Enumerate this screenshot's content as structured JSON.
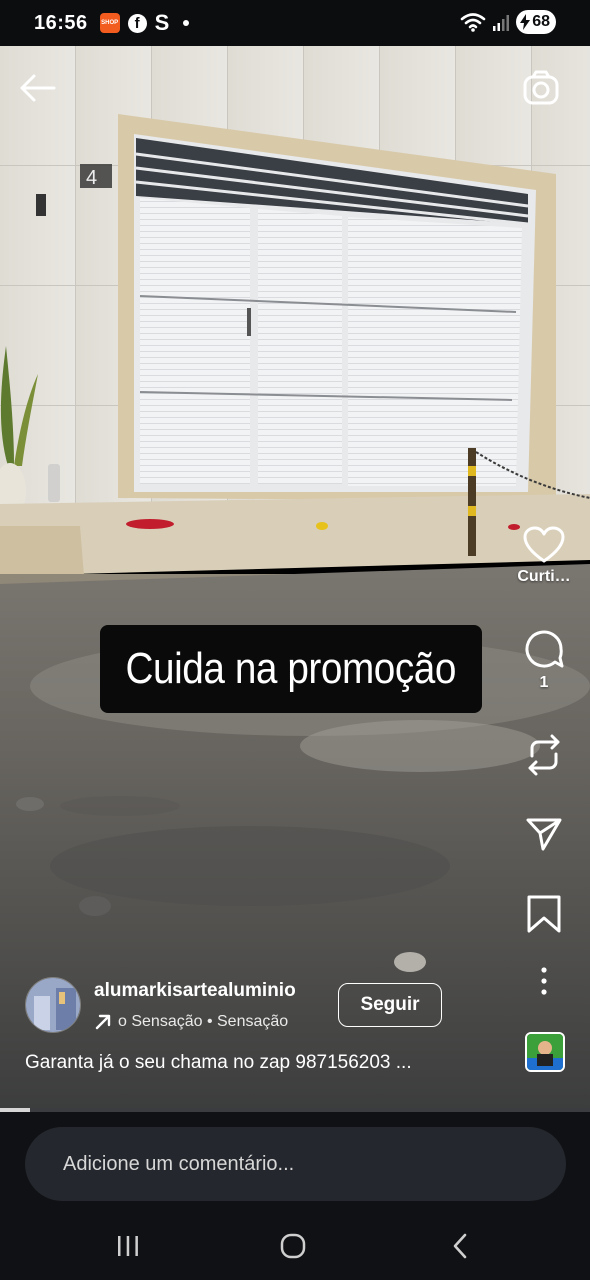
{
  "status_bar": {
    "time": "16:56",
    "battery_level": "68",
    "icons": [
      "shopee-icon",
      "facebook-icon",
      "s-app-icon",
      "notification-dot-icon",
      "wifi-icon",
      "signal-icon",
      "battery-charging-icon"
    ]
  },
  "top_bar": {
    "icons": [
      "back-arrow-icon",
      "camera-icon"
    ]
  },
  "video": {
    "sticker_text": "Cuida na promoção",
    "house_number": "4"
  },
  "actions": {
    "like_label": "Curti…",
    "comments_count": "1",
    "icons": [
      "heart-icon",
      "comment-icon",
      "repost-icon",
      "share-icon",
      "bookmark-icon",
      "more-icon"
    ]
  },
  "author": {
    "username": "alumarkisartealuminio",
    "audio_text": "o Sensação • Sensação",
    "follow_label": "Seguir"
  },
  "description": "Garanta já o seu chama no zap 987156203 ...",
  "progress": 0.05,
  "comment": {
    "placeholder": "Adicione um comentário..."
  },
  "nav": {
    "icons": [
      "recent-apps-icon",
      "home-icon",
      "back-icon"
    ]
  },
  "colors": {
    "accent_orange": "#f25c1f",
    "comment_bg": "#24272d",
    "bottom_bg": "#0f1114"
  }
}
